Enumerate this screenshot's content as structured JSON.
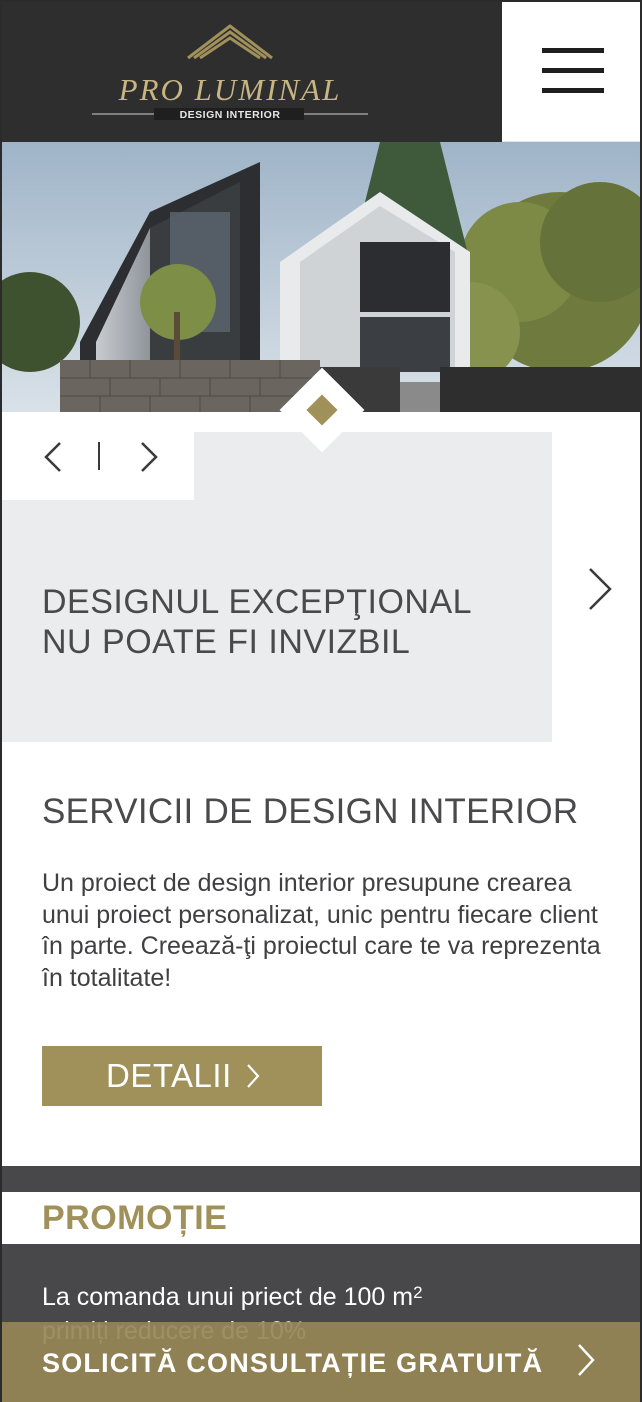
{
  "header": {
    "logo_text": "PRO LUMINAL",
    "logo_subtext": "DESIGN INTERIOR",
    "menu_icon": "hamburger-menu-icon"
  },
  "hero": {
    "image_alt": "modern house exterior photo",
    "indicator_icon": "diamond-icon"
  },
  "slider": {
    "prev_icon": "chevron-left-icon",
    "next_icon": "chevron-right-icon",
    "separator": "|",
    "title_line1": "DESIGNUL EXCEPŢIONAL",
    "title_line2": "NU POATE FI INVIZBIL"
  },
  "services": {
    "title": "SERVICII DE DESIGN INTERIOR",
    "text": "Un proiect de design interior presupune crearea unui proiect personalizat, unic pentru fiecare client în parte. Creează-ţi proiectul care te va reprezenta în totalitate!",
    "button_label": "DETALII"
  },
  "promo": {
    "title": "PROMOȚIE",
    "line1": "La comanda unui priect de 100 m",
    "line1_sup": "2",
    "line2": "primiți reducere de 10%"
  },
  "cta": {
    "label": "SOLICITĂ CONSULTAȚIE GRATUITĂ"
  },
  "colors": {
    "accent_gold": "#a0905a",
    "dark_header": "#2e2e2f",
    "promo_dark": "#48484a",
    "card_grey": "#ebecee"
  }
}
